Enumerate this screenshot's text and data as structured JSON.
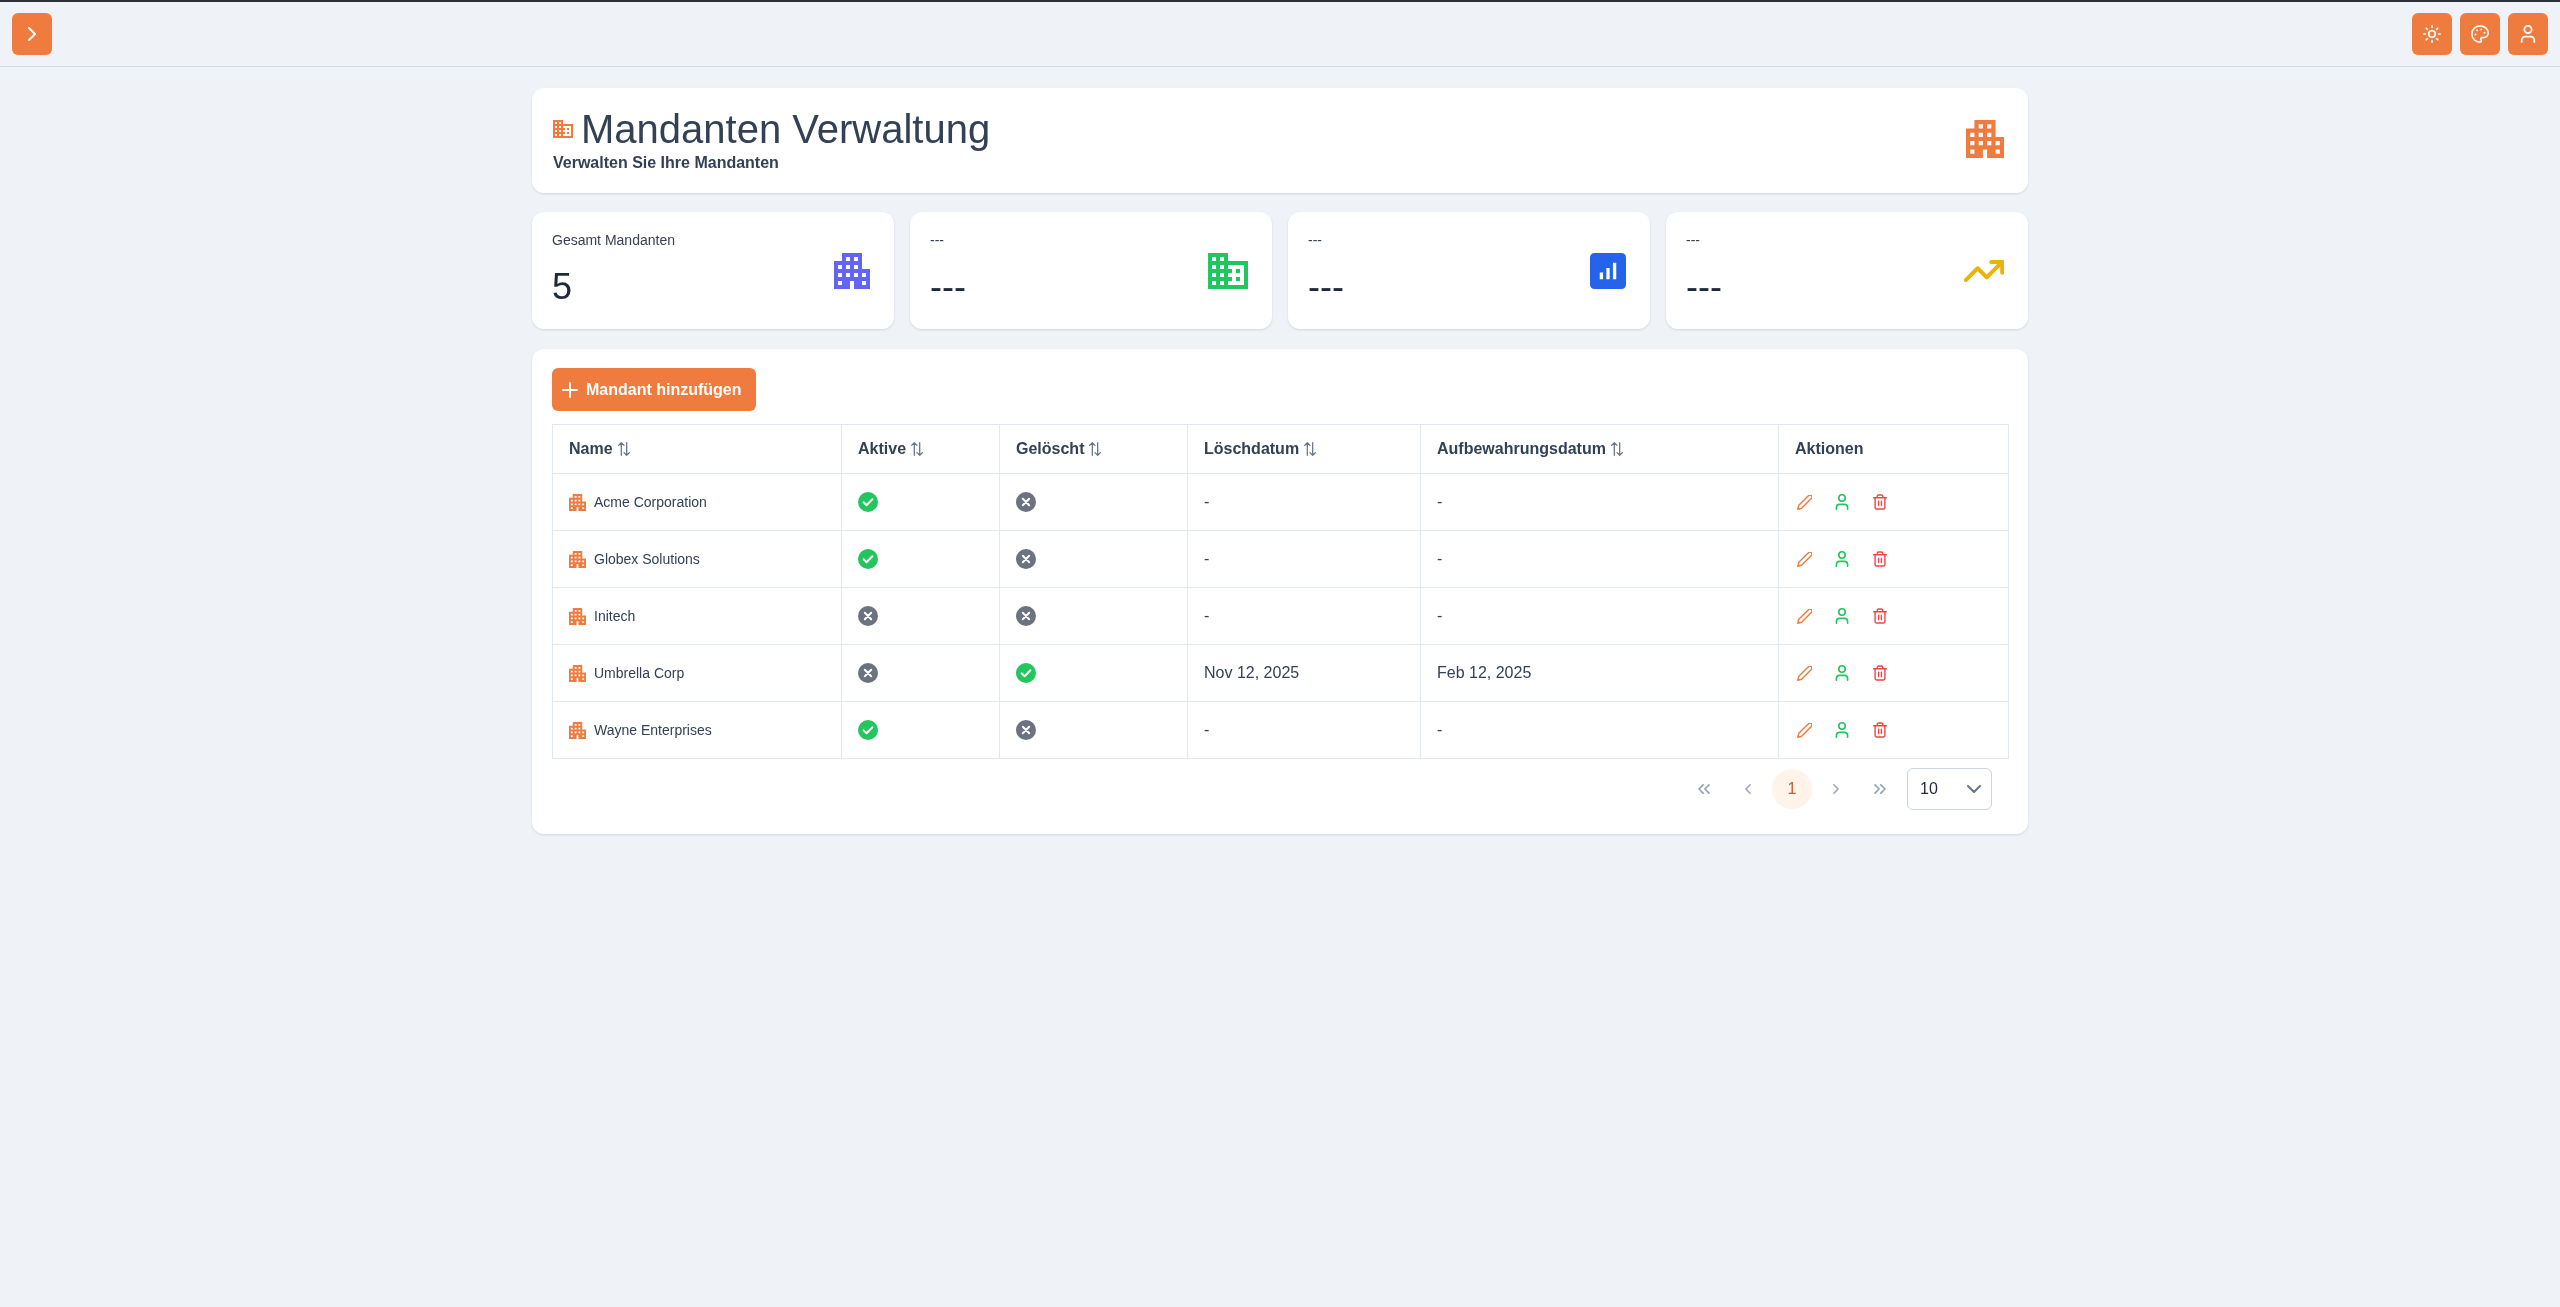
{
  "header": {
    "title": "Mandanten Verwaltung",
    "subtitle": "Verwalten Sie Ihre Mandanten"
  },
  "stats": [
    {
      "label": "Gesamt Mandanten",
      "value": "5",
      "kind": "apartment",
      "color": "#6366f1"
    },
    {
      "label": "---",
      "value": "---",
      "kind": "domain",
      "color": "#22c55e"
    },
    {
      "label": "---",
      "value": "---",
      "kind": "chart",
      "color": "#2563eb"
    },
    {
      "label": "---",
      "value": "---",
      "kind": "trend",
      "color": "#eab308"
    }
  ],
  "toolbar": {
    "add_button": "Mandant hinzufügen"
  },
  "table": {
    "columns": [
      {
        "label": "Name",
        "sortable": true
      },
      {
        "label": "Aktive",
        "sortable": true
      },
      {
        "label": "Gelöscht",
        "sortable": true
      },
      {
        "label": "Löschdatum",
        "sortable": true
      },
      {
        "label": "Aufbewahrungsdatum",
        "sortable": true
      },
      {
        "label": "Aktionen",
        "sortable": false
      }
    ],
    "rows": [
      {
        "name": "Acme Corporation",
        "active": true,
        "deleted": false,
        "deletion_date": "-",
        "retention_date": "-"
      },
      {
        "name": "Globex Solutions",
        "active": true,
        "deleted": false,
        "deletion_date": "-",
        "retention_date": "-"
      },
      {
        "name": "Initech",
        "active": false,
        "deleted": false,
        "deletion_date": "-",
        "retention_date": "-"
      },
      {
        "name": "Umbrella Corp",
        "active": false,
        "deleted": true,
        "deletion_date": "Nov 12, 2025",
        "retention_date": "Feb 12, 2025"
      },
      {
        "name": "Wayne Enterprises",
        "active": true,
        "deleted": false,
        "deletion_date": "-",
        "retention_date": "-"
      }
    ]
  },
  "pagination": {
    "pages": [
      {
        "label": "1",
        "selected": true
      }
    ],
    "page_size": "10"
  }
}
